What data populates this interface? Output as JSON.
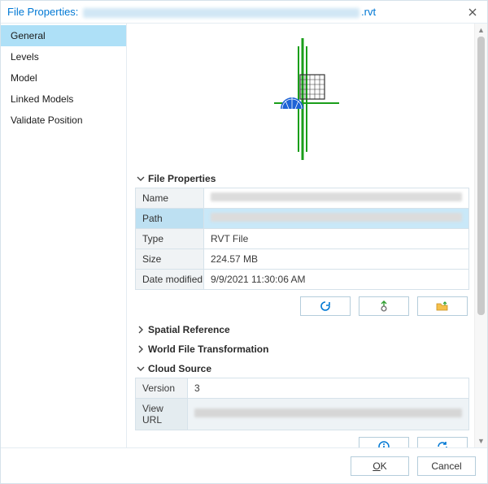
{
  "title": {
    "prefix": "File Properties: ",
    "suffix": ".rvt"
  },
  "sidebar": {
    "items": [
      {
        "label": "General",
        "selected": true
      },
      {
        "label": "Levels"
      },
      {
        "label": "Model"
      },
      {
        "label": "Linked Models"
      },
      {
        "label": "Validate Position"
      }
    ]
  },
  "sections": {
    "fileProps": {
      "label": "File Properties",
      "expanded": true
    },
    "spatialRef": {
      "label": "Spatial Reference",
      "expanded": false
    },
    "worldFile": {
      "label": "World File Transformation",
      "expanded": false
    },
    "cloud": {
      "label": "Cloud Source",
      "expanded": true
    }
  },
  "fileProps": {
    "rows": {
      "name": {
        "label": "Name",
        "blurred": true
      },
      "path": {
        "label": "Path",
        "blurred": true,
        "highlight": true
      },
      "type": {
        "label": "Type",
        "value": "RVT File"
      },
      "size": {
        "label": "Size",
        "value": "224.57 MB"
      },
      "date": {
        "label": "Date modified",
        "value": "9/9/2021 11:30:06 AM"
      }
    }
  },
  "cloud": {
    "rows": {
      "version": {
        "label": "Version",
        "value": "3"
      },
      "viewurl": {
        "label": "View URL",
        "blurred": true,
        "highlight": true
      }
    }
  },
  "footer": {
    "ok": "OK",
    "okMnemonic": "O",
    "okRest": "K",
    "cancel": "Cancel"
  },
  "icons": {
    "refresh": "refresh-icon",
    "export": "export-gear-icon",
    "open": "folder-open-icon",
    "info": "info-icon",
    "sync": "sync-icon"
  }
}
